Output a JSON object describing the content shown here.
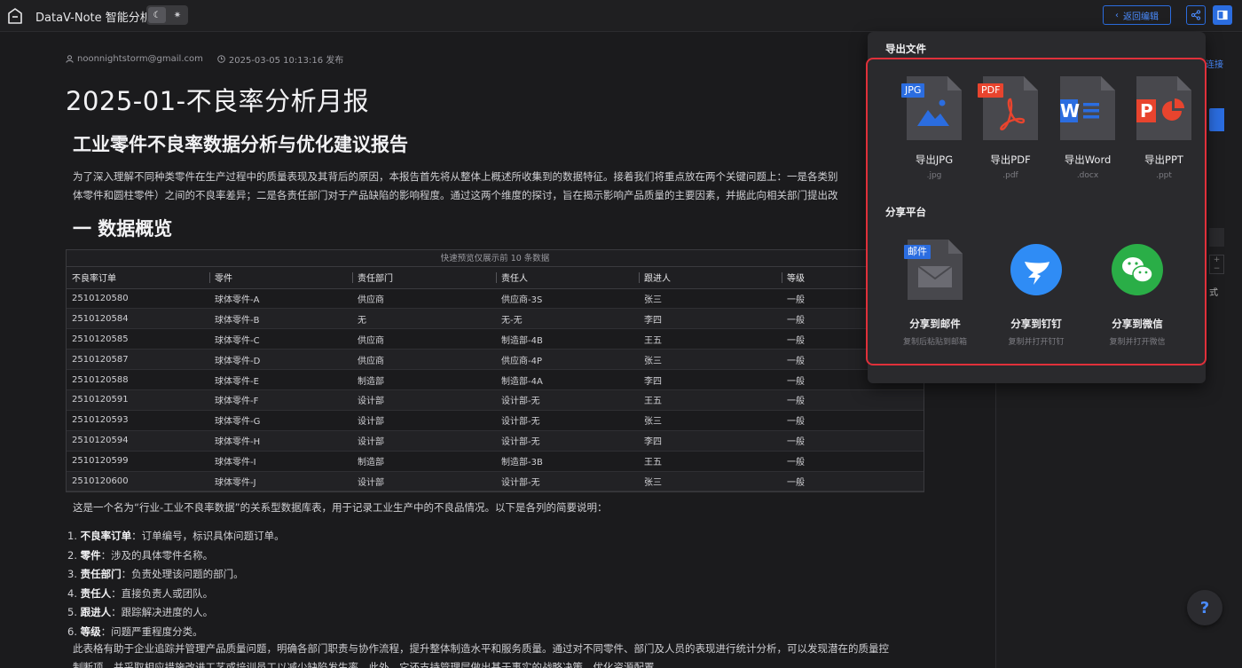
{
  "header": {
    "app_title": "DataV-Note 智能分析",
    "back_label": "返回编辑",
    "colors": {
      "accent": "#2b6de0",
      "highlight": "#e0303a"
    }
  },
  "doc": {
    "author": "noonnightstorm@gmail.com",
    "published": "2025-03-05 10:13:16 发布",
    "title": "2025-01-不良率分析月报",
    "heading1": "工业零件不良率数据分析与优化建议报告",
    "para1_line1": "为了深入理解不同种类零件在生产过程中的质量表现及其背后的原因，本报告首先将从整体上概述所收集到的数据特征。接着我们将重点放在两个关键问题上：一是各类别",
    "para1_line2": "体零件和圆柱零件）之间的不良率差异；二是各责任部门对于产品缺陷的影响程度。通过这两个维度的探讨，旨在揭示影响产品质量的主要因素，并据此向相关部门提出改",
    "heading2": "一 数据概览",
    "table_caption": "快速预览仅展示前 10 条数据",
    "table_headers": [
      "不良率订单",
      "零件",
      "责任部门",
      "责任人",
      "跟进人",
      "等级"
    ],
    "table_rows": [
      [
        "2510120580",
        "球体零件-A",
        "供应商",
        "供应商-3S",
        "张三",
        "一般"
      ],
      [
        "2510120584",
        "球体零件-B",
        "无",
        "无-无",
        "李四",
        "一般"
      ],
      [
        "2510120585",
        "球体零件-C",
        "供应商",
        "制造部-4B",
        "王五",
        "一般"
      ],
      [
        "2510120587",
        "球体零件-D",
        "供应商",
        "供应商-4P",
        "张三",
        "一般"
      ],
      [
        "2510120588",
        "球体零件-E",
        "制造部",
        "制造部-4A",
        "李四",
        "一般"
      ],
      [
        "2510120591",
        "球体零件-F",
        "设计部",
        "设计部-无",
        "王五",
        "一般"
      ],
      [
        "2510120593",
        "球体零件-G",
        "设计部",
        "设计部-无",
        "张三",
        "一般"
      ],
      [
        "2510120594",
        "球体零件-H",
        "设计部",
        "设计部-无",
        "李四",
        "一般"
      ],
      [
        "2510120599",
        "球体零件-I",
        "制造部",
        "制造部-3B",
        "王五",
        "一般"
      ],
      [
        "2510120600",
        "球体零件-J",
        "设计部",
        "设计部-无",
        "张三",
        "一般"
      ]
    ],
    "para2": "这是一个名为“行业-工业不良率数据”的关系型数据库表，用于记录工业生产中的不良品情况。以下是各列的简要说明：",
    "list": [
      {
        "num": "1.",
        "term": "不良率订单",
        "desc": "：订单编号，标识具体问题订单。"
      },
      {
        "num": "2.",
        "term": "零件",
        "desc": "：涉及的具体零件名称。"
      },
      {
        "num": "3.",
        "term": "责任部门",
        "desc": "：负责处理该问题的部门。"
      },
      {
        "num": "4.",
        "term": "责任人",
        "desc": "：直接负责人或团队。"
      },
      {
        "num": "5.",
        "term": "跟进人",
        "desc": "：跟踪解决进度的人。"
      },
      {
        "num": "6.",
        "term": "等级",
        "desc": "：问题严重程度分类。"
      }
    ],
    "para3_line1": "此表格有助于企业追踪并管理产品质量问题，明确各部门职责与协作流程，提升整体制造水平和服务质量。通过对不同零件、部门及人员的表现进行统计分析，可以发现潜在的质量控",
    "para3_line2": "制断项，并采取相应措施改进工艺或培训员工以减少缺陷发生率。此外，它还支持管理层做出基于事实的战略决策，优化资源配置。"
  },
  "sidebar": {
    "link_fragment": "连接",
    "text_fragment": "式",
    "help_label": "?"
  },
  "export": {
    "section_export": "导出文件",
    "files": [
      {
        "tag": "JPG",
        "label": "导出JPG",
        "ext": ".jpg",
        "color": "#2b6de0"
      },
      {
        "tag": "PDF",
        "label": "导出PDF",
        "ext": ".pdf",
        "color": "#e8442e"
      },
      {
        "tag": "W",
        "label": "导出Word",
        "ext": ".docx",
        "color": "#2b6de0"
      },
      {
        "tag": "P",
        "label": "导出PPT",
        "ext": ".ppt",
        "color": "#e8442e"
      }
    ],
    "section_share": "分享平台",
    "shares": [
      {
        "label": "分享到邮件",
        "sub": "复制后粘贴到邮箱",
        "tag": "邮件"
      },
      {
        "label": "分享到钉钉",
        "sub": "复制并打开钉钉"
      },
      {
        "label": "分享到微信",
        "sub": "复制并打开微信"
      }
    ]
  }
}
